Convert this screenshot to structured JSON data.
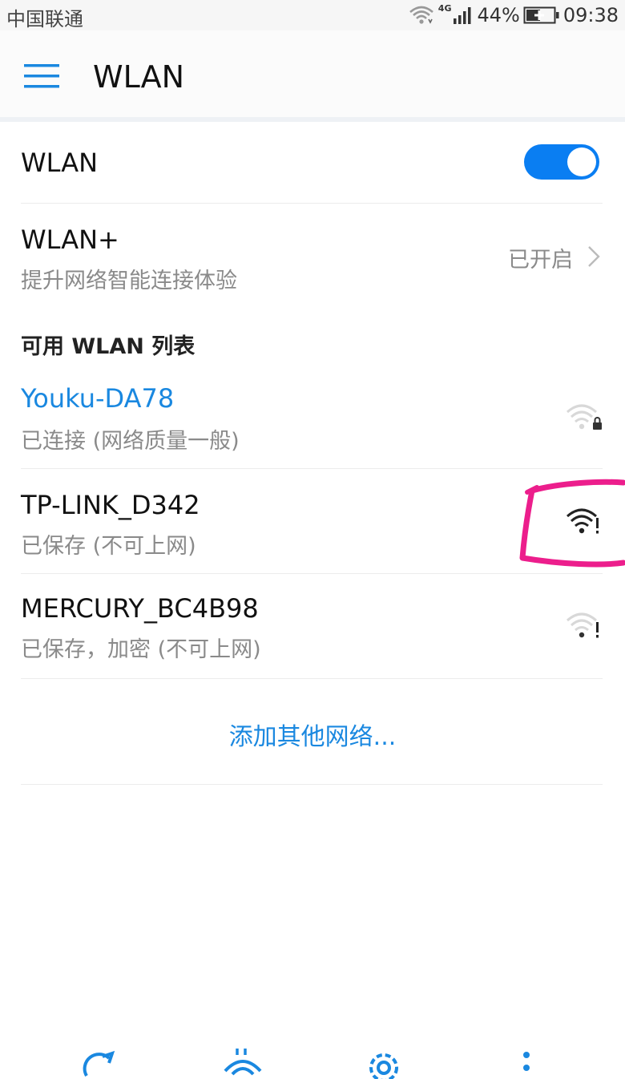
{
  "status_bar": {
    "carrier": "中国联通",
    "network_type": "4G",
    "battery": "44%",
    "time": "09:38"
  },
  "app_bar": {
    "title": "WLAN",
    "menu_icon": "hamburger-menu-icon"
  },
  "wlan_toggle": {
    "label": "WLAN",
    "state": "on"
  },
  "wlan_plus": {
    "title": "WLAN+",
    "subtitle": "提升网络智能连接体验",
    "status": "已开启"
  },
  "network_list": {
    "header": "可用 WLAN 列表",
    "networks": [
      {
        "name": "Youku-DA78",
        "status": "已连接 (网络质量一般)",
        "icon": "wifi-lock-icon"
      },
      {
        "name": "TP-LINK_D342",
        "status": "已保存 (不可上网)",
        "icon": "wifi-alert-icon"
      },
      {
        "name": "MERCURY_BC4B98",
        "status": "已保存，加密 (不可上网)",
        "icon": "wifi-alert-icon"
      }
    ]
  },
  "add_network": {
    "label": "添加其他网络..."
  },
  "colors": {
    "accent": "#0a7ef2",
    "link": "#1a88e0",
    "annotation": "#ec1e8c"
  }
}
